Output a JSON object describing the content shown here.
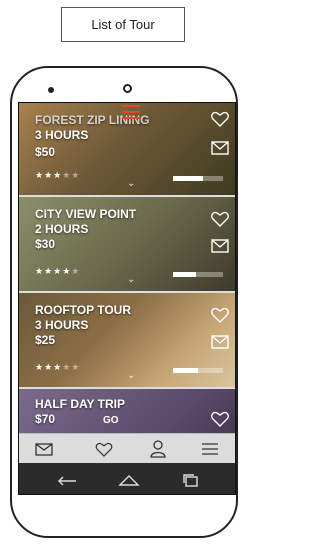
{
  "header": {
    "title": "List of Tour"
  },
  "tours": [
    {
      "name": "FOREST ZIP LINING",
      "duration": "3 HOURS",
      "price": "$50",
      "rating": 3,
      "rating_max": 5,
      "progress": 0.6
    },
    {
      "name": "CITY VIEW POINT",
      "duration": "2 HOURS",
      "price": "$30",
      "rating": 4,
      "rating_max": 5,
      "progress": 0.45
    },
    {
      "name": "ROOFTOP TOUR",
      "duration": "3 HOURS",
      "price": "$25",
      "rating": 3,
      "rating_max": 5,
      "progress": 0.5
    },
    {
      "name": "HALF DAY TRIP",
      "price": "$70"
    }
  ],
  "go_label": "GO",
  "bottom_nav": [
    "mail-icon",
    "heart-icon",
    "user-icon",
    "menu-icon"
  ],
  "system_nav": [
    "back-icon",
    "home-icon",
    "recents-icon"
  ],
  "colors": {
    "accent": "#e8452b",
    "nav_bg": "#dcdcdc",
    "system_bar": "#2b2b2b"
  }
}
